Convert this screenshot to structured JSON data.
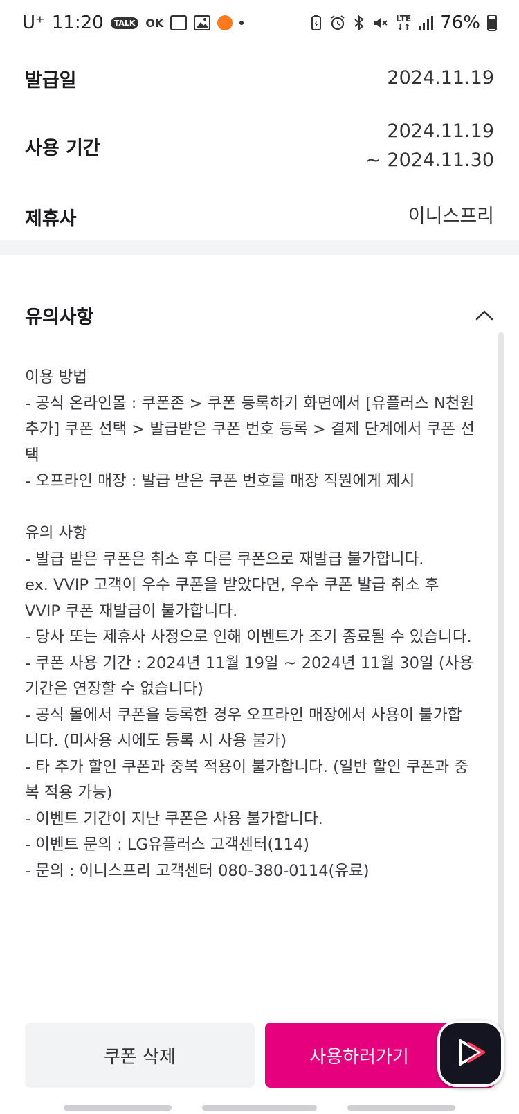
{
  "status_bar": {
    "carrier": "U⁺",
    "time": "11:20",
    "talk_badge": "TALK",
    "ok_badge": "OK",
    "battery_percent": "76%",
    "lte_label": "LTE",
    "battery_level": 0.76
  },
  "details": {
    "issue_date_label": "발급일",
    "issue_date_value": "2024.11.19",
    "period_label": "사용 기간",
    "period_start": "2024.11.19",
    "period_end": "~ 2024.11.30",
    "partner_label": "제휴사",
    "partner_value": "이니스프리"
  },
  "notice": {
    "title": "유의사항",
    "lines": [
      "이용 방법",
      "- 공식 온라인몰 : 쿠폰존 > 쿠폰 등록하기 화면에서 [유플러스 N천원",
      "추가] 쿠폰 선택 > 발급받은 쿠폰 번호 등록 > 결제 단계에서 쿠폰 선",
      "택",
      "- 오프라인 매장 : 발급 받은 쿠폰 번호를 매장 직원에게 제시",
      "",
      "유의 사항",
      "- 발급 받은 쿠폰은 취소 후 다른 쿠폰으로 재발급 불가합니다.",
      "ex. VVIP 고객이 우수 쿠폰을 받았다면, 우수 쿠폰 발급 취소 후",
      "VVIP 쿠폰 재발급이 불가합니다.",
      "- 당사 또는 제휴사 사정으로 인해 이벤트가 조기 종료될 수 있습니다.",
      "- 쿠폰 사용 기간 : 2024년 11월 19일 ~ 2024년 11월 30일 (사용",
      "기간은 연장할 수 없습니다)",
      "- 공식 몰에서 쿠폰을 등록한 경우 오프라인 매장에서 사용이 불가합",
      "니다. (미사용 시에도 등록 시 사용 불가)",
      "- 타 추가 할인 쿠폰과 중복 적용이 불가합니다. (일반 할인 쿠폰과 중",
      "복 적용 가능)",
      "- 이벤트 기간이 지난 쿠폰은 사용 불가합니다.",
      "- 이벤트 문의 : LG유플러스 고객센터(114)",
      "- 문의 : 이니스프리 고객센터 080-380-0114(유료)"
    ]
  },
  "buttons": {
    "delete_label": "쿠폰 삭제",
    "use_label": "사용하러가기"
  },
  "colors": {
    "accent": "#e6007e",
    "fab_bg": "#151521",
    "fab_play": "#ff3b5c"
  },
  "icons": {
    "chevron": "chevron-up-icon",
    "play": "play-icon"
  }
}
